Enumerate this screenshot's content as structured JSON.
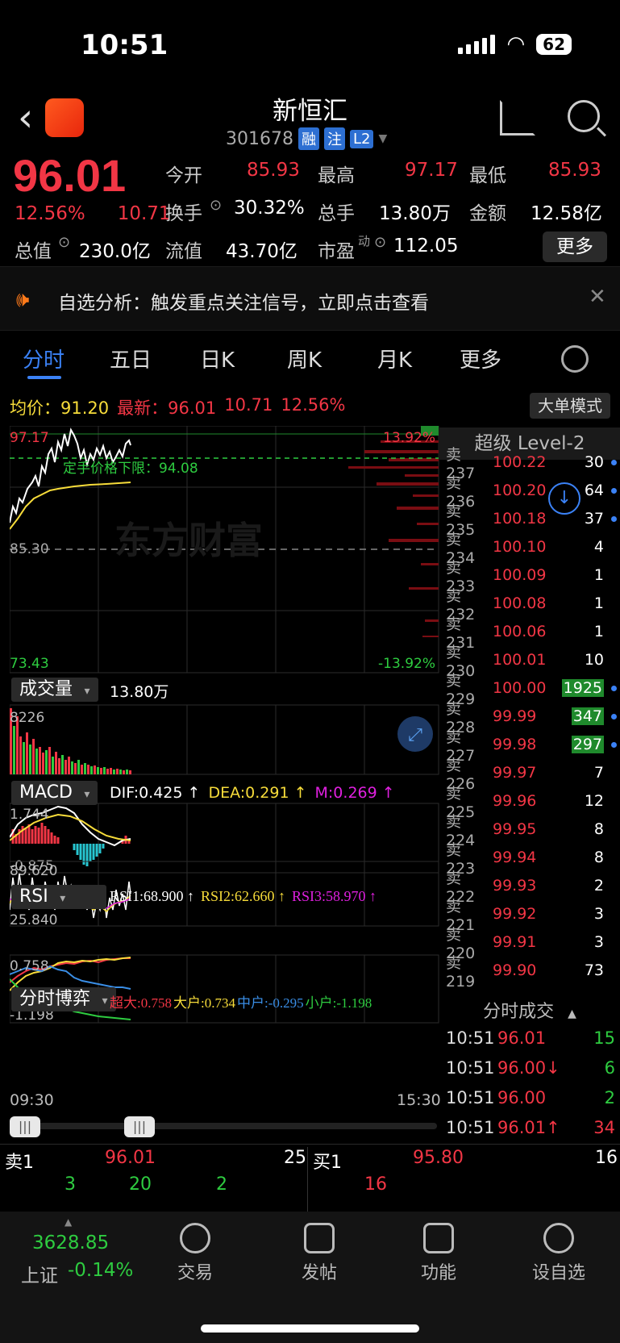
{
  "status": {
    "time": "10:51",
    "battery": "62"
  },
  "header": {
    "stock_name": "新恒汇",
    "code": "301678",
    "tags": [
      "融",
      "注",
      "L2"
    ]
  },
  "quote": {
    "price": "96.01",
    "pct": "12.56%",
    "chg": "10.71",
    "open_label": "今开",
    "open": "85.93",
    "high_label": "最高",
    "high": "97.17",
    "low_label": "最低",
    "low": "85.93",
    "turnover_label": "换手",
    "turnover": "30.32%",
    "vol_label": "总手",
    "vol": "13.80万",
    "amount_label": "金额",
    "amount": "12.58亿",
    "mcap_label": "总值",
    "mcap": "230.0亿",
    "float_label": "流值",
    "float": "43.70亿",
    "pe_label": "市盈",
    "pe_sup": "动",
    "pe": "112.05",
    "more": "更多"
  },
  "banner": {
    "text": "自选分析：触发重点关注信号，立即点击查看"
  },
  "tabs": [
    "分时",
    "五日",
    "日K",
    "周K",
    "月K",
    "更多"
  ],
  "avg_row": {
    "avg_label": "均价：",
    "avg": "91.20",
    "last_label": "最新：",
    "last": "96.01",
    "chg": "10.71",
    "pct": "12.56%"
  },
  "bigorder_btn": "大单模式",
  "chart": {
    "top_left": "97.17",
    "top_right": "13.92%",
    "mid_left": "85.30",
    "bot_left": "73.43",
    "bot_right": "-13.92%",
    "limit_label": "定手价格下限：94.08",
    "vol_sel": "成交量",
    "vol_val": "13.80万",
    "vol_max": "8226",
    "macd_sel": "MACD",
    "dif": "DIF:0.425 ↑",
    "dea": "DEA:0.291 ↑",
    "m": "M:0.269 ↑",
    "macd_hi": "1.744",
    "macd_lo": "-0.875",
    "rsi_sel": "RSI",
    "rsi1": "RSI1:68.900 ↑",
    "rsi2": "RSI2:62.660 ↑",
    "rsi3": "RSI3:58.970 ↑",
    "rsi_hi": "89.620",
    "rsi_lo": "25.840",
    "game_sel": "分时博弈",
    "super": "超大:0.758",
    "big": "大户:0.734",
    "mid": "中户:-0.295",
    "small": "小户:-1.198",
    "game_hi": "0.758",
    "game_lo": "-1.198",
    "axis_start": "09:30",
    "axis_end": "15:30"
  },
  "orderbook": {
    "title": "超级 Level-2",
    "rows": [
      {
        "lbl": "卖 237",
        "px": "100.22",
        "vol": "30"
      },
      {
        "lbl": "卖 236",
        "px": "100.20",
        "vol": "64"
      },
      {
        "lbl": "卖 235",
        "px": "100.18",
        "vol": "37"
      },
      {
        "lbl": "卖 234",
        "px": "100.10",
        "vol": "4"
      },
      {
        "lbl": "卖 233",
        "px": "100.09",
        "vol": "1"
      },
      {
        "lbl": "卖 232",
        "px": "100.08",
        "vol": "1"
      },
      {
        "lbl": "卖 231",
        "px": "100.06",
        "vol": "1"
      },
      {
        "lbl": "卖 230",
        "px": "100.01",
        "vol": "10"
      },
      {
        "lbl": "卖 229",
        "px": "100.00",
        "vol": "1925"
      },
      {
        "lbl": "卖 228",
        "px": "99.99",
        "vol": "347"
      },
      {
        "lbl": "卖 227",
        "px": "99.98",
        "vol": "297"
      },
      {
        "lbl": "卖 226",
        "px": "99.97",
        "vol": "7"
      },
      {
        "lbl": "卖 225",
        "px": "99.96",
        "vol": "12"
      },
      {
        "lbl": "卖 224",
        "px": "99.95",
        "vol": "8"
      },
      {
        "lbl": "卖 223",
        "px": "99.94",
        "vol": "8"
      },
      {
        "lbl": "卖 222",
        "px": "99.93",
        "vol": "2"
      },
      {
        "lbl": "卖 221",
        "px": "99.92",
        "vol": "3"
      },
      {
        "lbl": "卖 220",
        "px": "99.91",
        "vol": "3"
      },
      {
        "lbl": "卖 219",
        "px": "99.90",
        "vol": "73"
      }
    ]
  },
  "ticks": {
    "title": "分时成交",
    "rows": [
      {
        "t": "10:51",
        "p": "96.01",
        "v": "15"
      },
      {
        "t": "10:51",
        "p": "96.00↓",
        "v": "6"
      },
      {
        "t": "10:51",
        "p": "96.00",
        "v": "2"
      },
      {
        "t": "10:51",
        "p": "96.01↑",
        "v": "34"
      }
    ]
  },
  "bidask": {
    "sell1_label": "卖1",
    "sell1_px": "96.01",
    "sell1_vol": "25",
    "buy1_label": "买1",
    "buy1_px": "95.80",
    "buy1_vol": "16",
    "q1": "3",
    "q2": "20",
    "q3": "2",
    "q4": "16"
  },
  "nav": {
    "index_val": "3628.85",
    "index_name": "上证",
    "index_pct": "-0.14%",
    "items": [
      "交易",
      "发帖",
      "功能",
      "设自选"
    ]
  }
}
